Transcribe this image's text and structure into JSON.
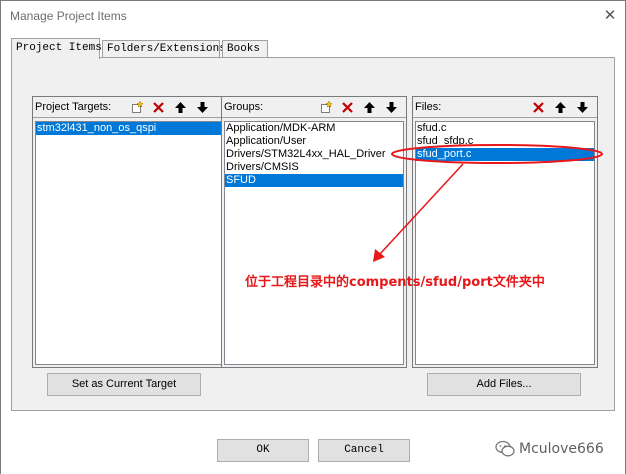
{
  "window": {
    "title": "Manage Project Items",
    "close_glyph": "✕"
  },
  "tabs": [
    {
      "label": "Project Items",
      "active": true
    },
    {
      "label": "Folders/Extensions",
      "active": false
    },
    {
      "label": "Books",
      "active": false
    }
  ],
  "targets": {
    "label": "Project Targets:",
    "items": [
      {
        "text": "stm32l431_non_os_qspi",
        "selected": true
      }
    ],
    "icons": [
      "new-icon",
      "delete-icon",
      "move-up-icon",
      "move-down-icon"
    ]
  },
  "groups": {
    "label": "Groups:",
    "items": [
      {
        "text": "Application/MDK-ARM",
        "selected": false
      },
      {
        "text": "Application/User",
        "selected": false
      },
      {
        "text": "Drivers/STM32L4xx_HAL_Driver",
        "selected": false
      },
      {
        "text": "Drivers/CMSIS",
        "selected": false
      },
      {
        "text": "SFUD",
        "selected": true
      }
    ],
    "icons": [
      "new-icon",
      "delete-icon",
      "move-up-icon",
      "move-down-icon"
    ]
  },
  "files": {
    "label": "Files:",
    "items": [
      {
        "text": "sfud.c",
        "selected": false
      },
      {
        "text": "sfud_sfdp.c",
        "selected": false
      },
      {
        "text": "sfud_port.c",
        "selected": true
      }
    ],
    "icons": [
      "delete-icon",
      "move-up-icon",
      "move-down-icon"
    ]
  },
  "buttons": {
    "set_current_target": "Set as Current Target",
    "add_files": "Add Files...",
    "ok": "OK",
    "cancel": "Cancel"
  },
  "annotation": {
    "text": "位于工程目录中的compents/sfud/port文件夹中",
    "color": "#e8181a"
  },
  "watermark": {
    "text": "Mculove666"
  },
  "colors": {
    "selection": "#0078d7",
    "annotation_red": "#e8181a"
  }
}
